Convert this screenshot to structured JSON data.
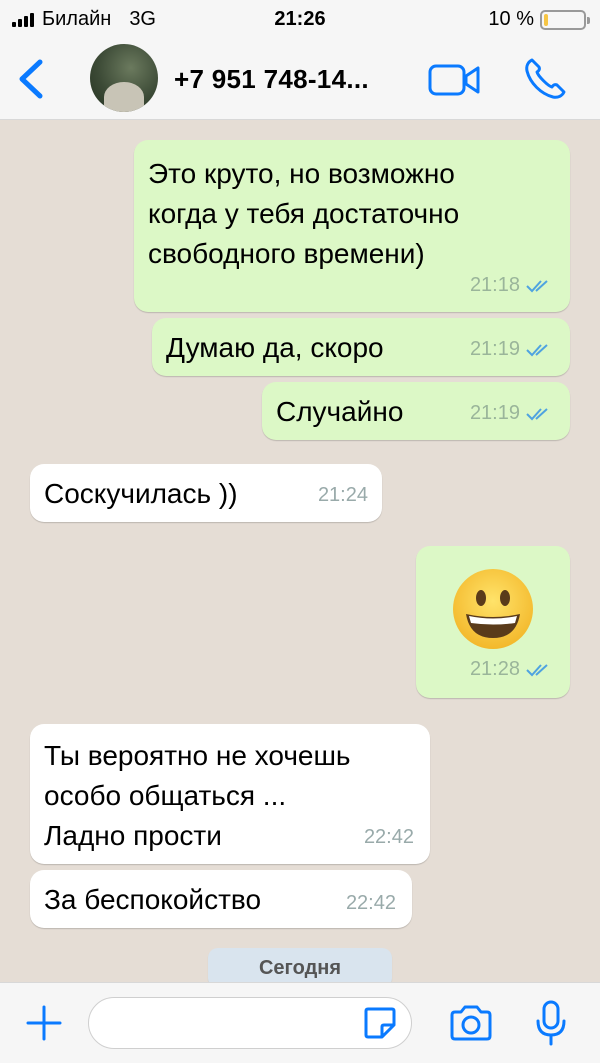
{
  "status_bar": {
    "carrier": "Билайн",
    "network": "3G",
    "time": "21:26",
    "battery_text": "10 %",
    "battery_level": 0.1
  },
  "header": {
    "contact_name": "+7 951 748-14..."
  },
  "messages": [
    {
      "direction": "out",
      "text": "Это круто, но возможно\nкогда у тебя достаточно\nсвободного времени)",
      "time": "21:18",
      "status": "read"
    },
    {
      "direction": "out",
      "text": "Думаю да, скоро",
      "time": "21:19",
      "status": "read"
    },
    {
      "direction": "out",
      "text": "Случайно",
      "time": "21:19",
      "status": "read"
    },
    {
      "direction": "in",
      "text": "Соскучилась ))",
      "time": "21:24"
    },
    {
      "direction": "out",
      "emoji": "grinning-face",
      "time": "21:28",
      "status": "read"
    },
    {
      "direction": "in",
      "text": "Ты вероятно не хочешь\nособо общаться ...\nЛадно прости",
      "time": "22:42"
    },
    {
      "direction": "in",
      "text": "За беспокойство",
      "time": "22:42"
    }
  ],
  "date_chip": "Сегодня",
  "input": {
    "placeholder": "",
    "value": ""
  },
  "colors": {
    "accent": "#0a7aff",
    "outgoing_bubble": "#dcf8c6",
    "incoming_bubble": "#ffffff",
    "read_tick": "#4fa3e0"
  }
}
